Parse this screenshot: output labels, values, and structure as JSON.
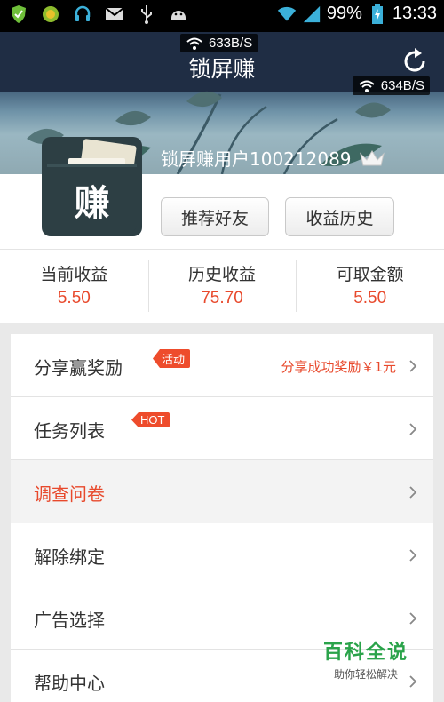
{
  "status_bar": {
    "battery": "99%",
    "time": "13:33",
    "icons": [
      "shield-icon",
      "coin-icon",
      "headset-icon",
      "mail-icon",
      "usb-icon",
      "android-icon",
      "wifi-icon",
      "signal-icon",
      "battery-icon"
    ]
  },
  "header": {
    "title": "锁屏赚",
    "net_speed_1": "633B/S",
    "net_speed_2": "634B/S",
    "username": "锁屏赚用户100212089",
    "refresh_icon": "refresh-icon",
    "crown_icon": "crown-icon"
  },
  "avatar": {
    "char": "赚"
  },
  "buttons": {
    "recommend": "推荐好友",
    "history": "收益历史"
  },
  "stats": [
    {
      "label": "当前收益",
      "value": "5.50"
    },
    {
      "label": "历史收益",
      "value": "75.70"
    },
    {
      "label": "可取金额",
      "value": "5.50"
    }
  ],
  "menu": [
    {
      "label": "分享赢奖励",
      "tag": "活动",
      "note": "分享成功奖励￥1元"
    },
    {
      "label": "任务列表",
      "tag": "HOT"
    },
    {
      "label": "调查问卷"
    },
    {
      "label": "解除绑定"
    },
    {
      "label": "广告选择"
    },
    {
      "label": "帮助中心"
    }
  ],
  "watermark": {
    "title": "百科全说",
    "subtitle": "助你轻松解决"
  },
  "colors": {
    "accent": "#e8492c",
    "tag": "#ee4c2c",
    "header": "#1f2d44"
  }
}
